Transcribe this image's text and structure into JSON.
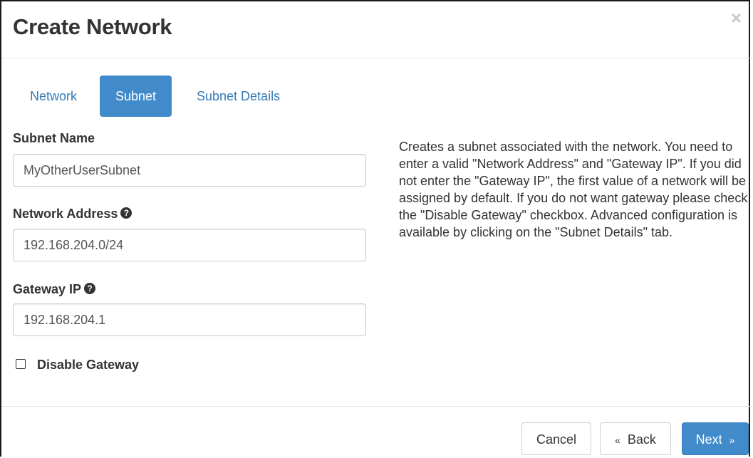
{
  "modal": {
    "title": "Create Network",
    "close_glyph": "×"
  },
  "tabs": [
    {
      "label": "Network",
      "active": false
    },
    {
      "label": "Subnet",
      "active": true
    },
    {
      "label": "Subnet Details",
      "active": false
    }
  ],
  "form": {
    "subnet_name_label": "Subnet Name",
    "subnet_name_value": "MyOtherUserSubnet",
    "network_address_label": "Network Address",
    "network_address_value": "192.168.204.0/24",
    "gateway_ip_label": "Gateway IP",
    "gateway_ip_value": "192.168.204.1",
    "disable_gateway_label": "Disable Gateway",
    "disable_gateway_checked": false,
    "help_glyph": "?"
  },
  "description": "Creates a subnet associated with the network. You need to enter a valid \"Network Address\" and \"Gateway IP\". If you did not enter the \"Gateway IP\", the first value of a network will be assigned by default. If you do not want gateway please check the \"Disable Gateway\" checkbox. Advanced configuration is available by clicking on the \"Subnet Details\" tab.",
  "footer": {
    "cancel_label": "Cancel",
    "back_label": "Back",
    "back_glyph": "«",
    "next_label": "Next",
    "next_glyph": "»"
  },
  "colors": {
    "primary": "#428bca",
    "link": "#337ab7",
    "border": "#cccccc",
    "text": "#333333"
  }
}
